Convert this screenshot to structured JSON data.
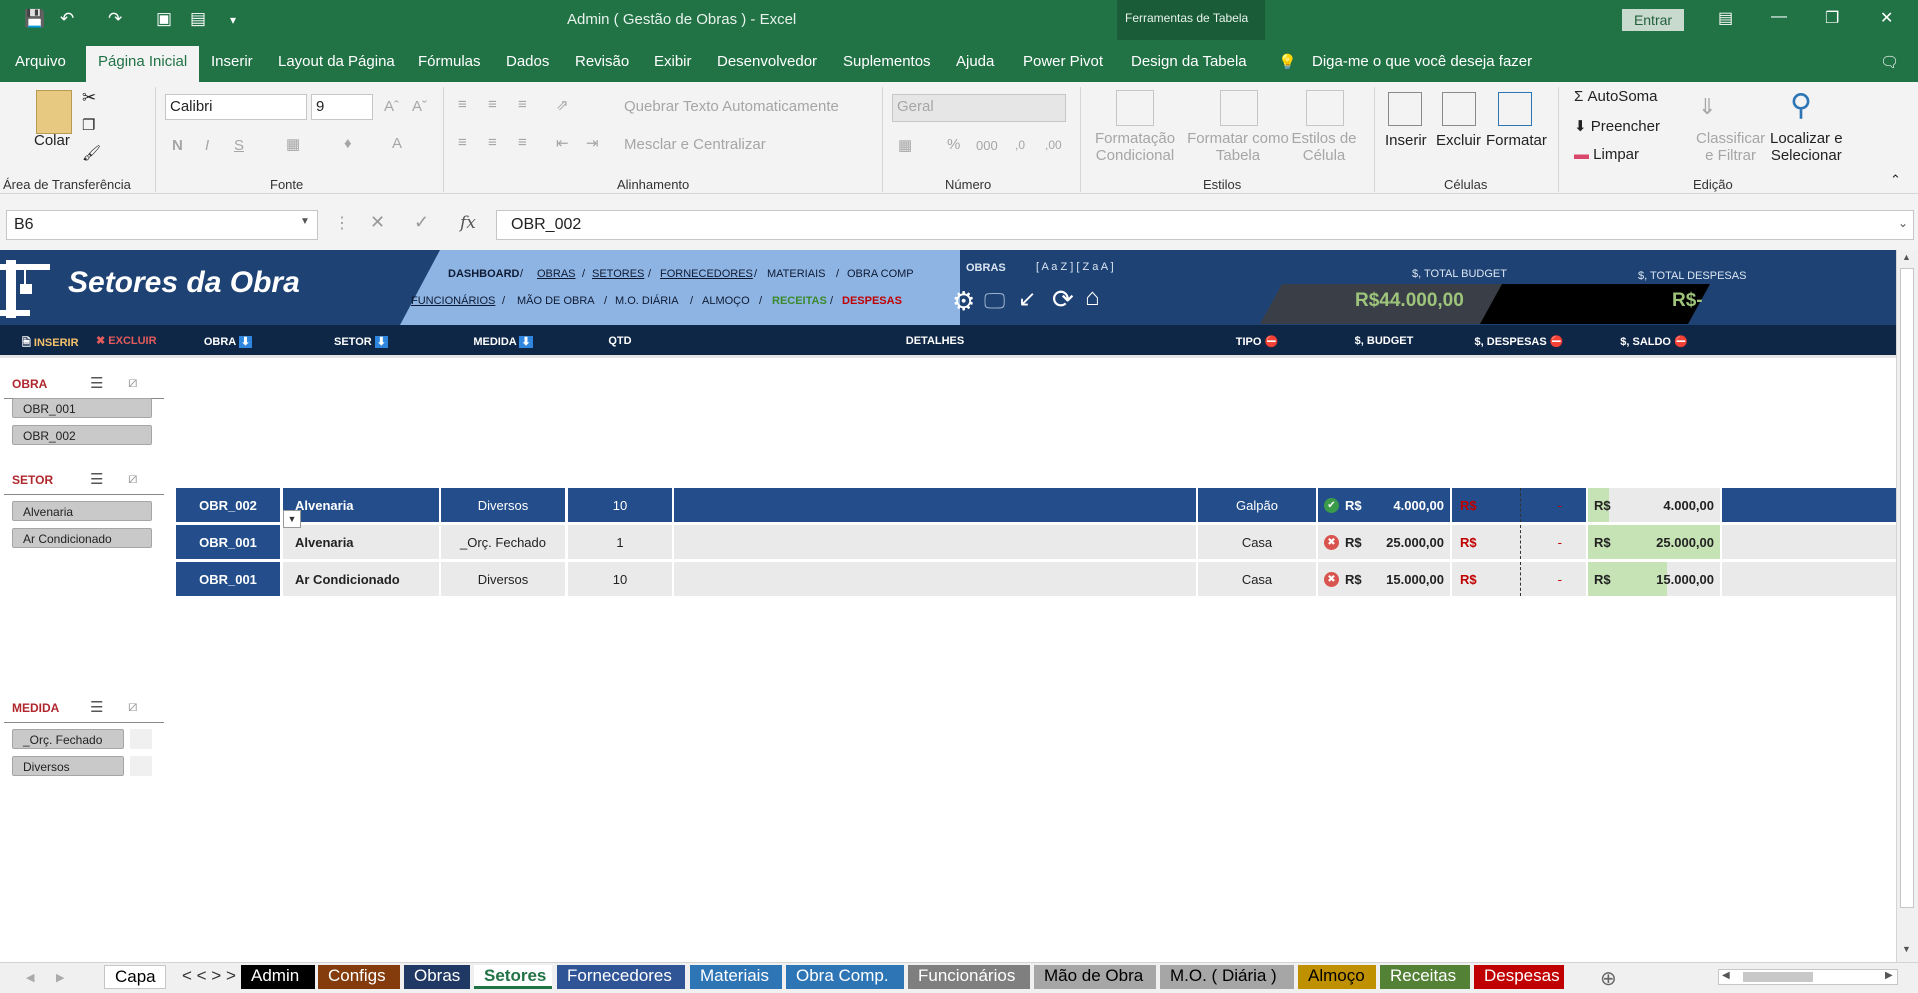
{
  "window": {
    "title": "Admin ( Gestão de Obras )  -  Excel",
    "context_tab": "Ferramentas de Tabela",
    "signin": "Entrar"
  },
  "menu": [
    "Arquivo",
    "Página Inicial",
    "Inserir",
    "Layout da Página",
    "Fórmulas",
    "Dados",
    "Revisão",
    "Exibir",
    "Desenvolvedor",
    "Suplementos",
    "Ajuda",
    "Power Pivot",
    "Design da Tabela"
  ],
  "tellme": "Diga-me o que você deseja fazer",
  "ribbon": {
    "clipboard": {
      "paste": "Colar",
      "label": "Área de Transferência"
    },
    "font": {
      "name": "Calibri",
      "size": "9",
      "bold": "N",
      "italic": "I",
      "underline": "S",
      "label": "Fonte"
    },
    "alignment": {
      "wrap": "Quebrar Texto Automaticamente",
      "merge": "Mesclar e Centralizar",
      "label": "Alinhamento"
    },
    "number": {
      "format": "Geral",
      "label": "Número"
    },
    "styles": {
      "cond": [
        "Formatação",
        "Condicional"
      ],
      "table": [
        "Formatar como",
        "Tabela"
      ],
      "cell": [
        "Estilos de",
        "Célula"
      ],
      "label": "Estilos"
    },
    "cells": {
      "insert": "Inserir",
      "delete": "Excluir",
      "format": "Formatar",
      "label": "Células"
    },
    "editing": {
      "autosum": "AutoSoma",
      "fill": "Preencher",
      "clear": "Limpar",
      "sort": [
        "Classificar",
        "e Filtrar"
      ],
      "find": [
        "Localizar e",
        "Selecionar"
      ],
      "label": "Edição"
    }
  },
  "formula_bar": {
    "name_box": "B6",
    "fx": "fx",
    "value": "OBR_002"
  },
  "banner": {
    "title": "Setores da Obra",
    "nav_row1": [
      "DASHBOARD",
      "OBRAS",
      "SETORES",
      "FORNECEDORES",
      "MATERIAIS",
      "OBRA COMP"
    ],
    "nav_row2": [
      "FUNCIONÁRIOS",
      "MÃO DE OBRA",
      "M.O. DIÁRIA",
      "ALMOÇO",
      "RECEITAS",
      "DESPESAS"
    ],
    "obras_label": "OBRAS",
    "sort_label": "[ A a Z ] [ Z a A ]",
    "budget_label": "$, TOTAL BUDGET",
    "budget_value": "R$44.000,00",
    "despesas_label": "$, TOTAL DESPESAS",
    "despesas_value": "R$-"
  },
  "actions": {
    "insert": "INSERIR",
    "delete": "EXCLUIR"
  },
  "columns": [
    "OBRA",
    "SETOR",
    "MEDIDA",
    "QTD",
    "DETALHES",
    "TIPO",
    "$, BUDGET",
    "$, DESPESAS",
    "$, SALDO"
  ],
  "rows": [
    {
      "obra": "OBR_002",
      "setor": "Alvenaria",
      "medida": "Diversos",
      "qtd": "10",
      "detalhes": "",
      "tipo": "Galpão",
      "cur": "R$",
      "budget": "4.000,00",
      "despesas": "-",
      "saldo": "4.000,00",
      "status": "ok",
      "saldo_fill": 0.16
    },
    {
      "obra": "OBR_001",
      "setor": "Alvenaria",
      "medida": "_Orç. Fechado",
      "qtd": "1",
      "detalhes": "",
      "tipo": "Casa",
      "cur": "R$",
      "budget": "25.000,00",
      "despesas": "-",
      "saldo": "25.000,00",
      "status": "x",
      "saldo_fill": 1.0
    },
    {
      "obra": "OBR_001",
      "setor": "Ar Condicionado",
      "medida": "Diversos",
      "qtd": "10",
      "detalhes": "",
      "tipo": "Casa",
      "cur": "R$",
      "budget": "15.000,00",
      "despesas": "-",
      "saldo": "15.000,00",
      "status": "x",
      "saldo_fill": 0.6
    }
  ],
  "slicers": {
    "obra": {
      "title": "OBRA",
      "items": [
        "OBR_001",
        "OBR_002"
      ]
    },
    "setor": {
      "title": "SETOR",
      "items": [
        "Alvenaria",
        "Ar Condicionado"
      ]
    },
    "medida": {
      "title": "MEDIDA",
      "items": [
        "_Orç. Fechado",
        "Diversos"
      ]
    }
  },
  "sheet_tabs": [
    {
      "label": "Capa",
      "color": "#ffffff",
      "text": "#000000"
    },
    {
      "label": "< < > >",
      "color": "#f0f0f0",
      "text": "#333333"
    },
    {
      "label": "Admin",
      "color": "#000000",
      "text": "#ffffff"
    },
    {
      "label": "Configs",
      "color": "#843c0c",
      "text": "#ffffff"
    },
    {
      "label": "Obras",
      "color": "#203864",
      "text": "#ffffff"
    },
    {
      "label": "Setores",
      "color": "#ffffff",
      "text": "#217346"
    },
    {
      "label": "Fornecedores",
      "color": "#2f5597",
      "text": "#ffffff"
    },
    {
      "label": "Materiais",
      "color": "#2e75b6",
      "text": "#ffffff"
    },
    {
      "label": "Obra Comp.",
      "color": "#2e75b6",
      "text": "#ffffff"
    },
    {
      "label": "Funcionários",
      "color": "#7f7f7f",
      "text": "#ffffff"
    },
    {
      "label": "Mão de Obra",
      "color": "#a6a6a6",
      "text": "#000000"
    },
    {
      "label": "M.O. ( Diária )",
      "color": "#a6a6a6",
      "text": "#000000"
    },
    {
      "label": "Almoço",
      "color": "#bf9000",
      "text": "#000000"
    },
    {
      "label": "Receitas",
      "color": "#538135",
      "text": "#ffffff"
    },
    {
      "label": "Despesas",
      "color": "#c00000",
      "text": "#ffffff"
    }
  ]
}
